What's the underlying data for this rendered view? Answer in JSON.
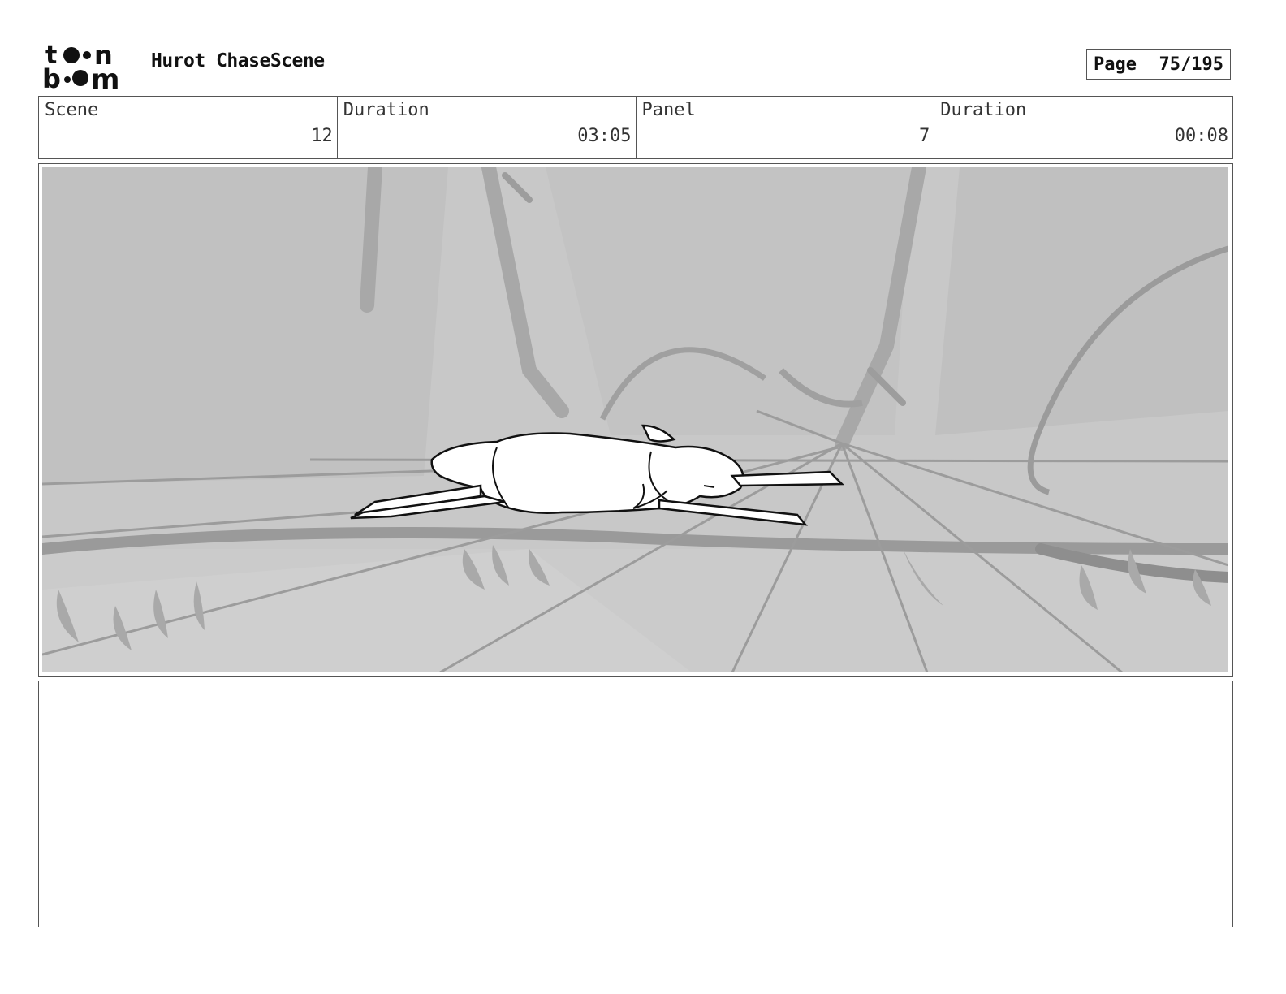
{
  "header": {
    "logo": {
      "text": "toon boom",
      "icon": "toon-boom-logo"
    },
    "title": "Hurot ChaseScene",
    "page_label": "Page",
    "page_number": "75/195"
  },
  "info": [
    {
      "label": "Scene",
      "value": "12"
    },
    {
      "label": "Duration",
      "value": "03:05"
    },
    {
      "label": "Panel",
      "value": "7"
    },
    {
      "label": "Duration",
      "value": "00:08"
    }
  ],
  "panel": {
    "image": "storyboard-sketch-deer-lying-on-ground"
  },
  "notes": {
    "text": ""
  },
  "colors": {
    "border": "#555555",
    "sketch_bg": "#c4c4c4",
    "sketch_dark": "#8e8e8e"
  }
}
